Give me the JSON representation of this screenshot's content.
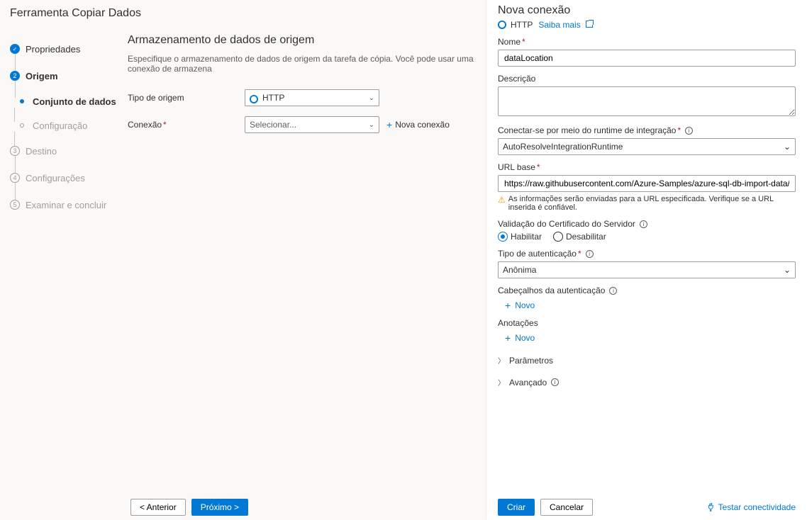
{
  "title": "Ferramenta Copiar Dados",
  "steps": {
    "s1": "Propriedades",
    "s2": "Origem",
    "s2a": "Conjunto de dados",
    "s2b": "Configuração",
    "s3": "Destino",
    "s4": "Configurações",
    "s5": "Examinar e concluir"
  },
  "content": {
    "heading": "Armazenamento de dados de origem",
    "desc": "Especifique o armazenamento de dados de origem da tarefa de cópia. Você pode usar uma conexão de armazena",
    "sourceTypeLabel": "Tipo de origem",
    "sourceTypeValue": "HTTP",
    "connectionLabel": "Conexão",
    "connectionPlaceholder": "Selecionar...",
    "newConnection": "Nova conexão"
  },
  "footer": {
    "back": "< Anterior",
    "next": "Próximo >"
  },
  "panel": {
    "title": "Nova conexão",
    "type": "HTTP",
    "learn": "Saiba mais",
    "nameLabel": "Nome",
    "nameValue": "dataLocation",
    "descLabel": "Descrição",
    "descValue": "",
    "irLabel": "Conectar-se por meio do runtime de integração",
    "irValue": "AutoResolveIntegrationRuntime",
    "urlLabel": "URL base",
    "urlValue": "https://raw.githubusercontent.com/Azure-Samples/azure-sql-db-import-data/main/json/user",
    "urlWarn": "As informações serão enviadas para a URL especificada. Verifique se a URL inserida é confiável.",
    "certLabel": "Validação do Certificado do Servidor",
    "certEnable": "Habilitar",
    "certDisable": "Desabilitar",
    "authLabel": "Tipo de autenticação",
    "authValue": "Anônima",
    "headersLabel": "Cabeçalhos da autenticação",
    "newItem": "Novo",
    "annotationsLabel": "Anotações",
    "params": "Parâmetros",
    "advanced": "Avançado",
    "create": "Criar",
    "cancel": "Cancelar",
    "test": "Testar conectividade"
  }
}
